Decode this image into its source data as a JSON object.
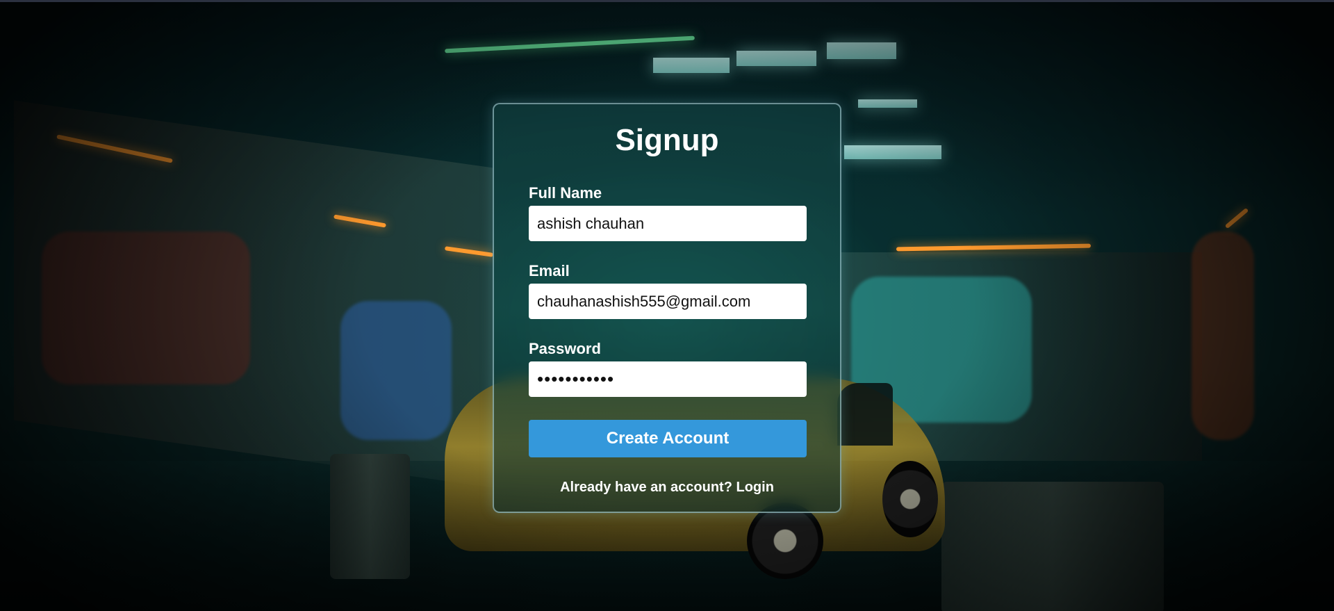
{
  "form": {
    "title": "Signup",
    "full_name": {
      "label": "Full Name",
      "value": "ashish chauhan"
    },
    "email": {
      "label": "Email",
      "value": "chauhanashish555@gmail.com"
    },
    "password": {
      "label": "Password",
      "value": "ashish12345"
    },
    "submit_label": "Create Account",
    "footer": {
      "prompt": "Already have an account?",
      "link_label": "Login"
    }
  },
  "colors": {
    "button": "#3498db",
    "text": "#ffffff",
    "input_background": "#ffffff"
  },
  "background": {
    "description_icon": "garage-background-image"
  }
}
